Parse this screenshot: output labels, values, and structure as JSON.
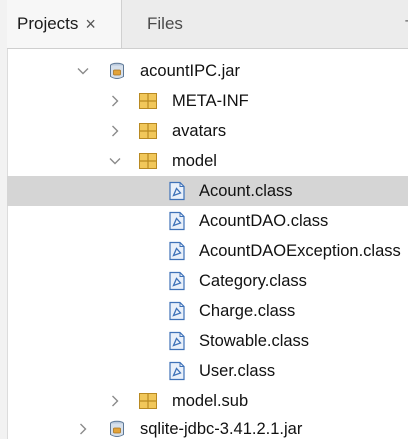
{
  "tabs": {
    "projects_label": "Projects",
    "close_glyph": "×",
    "files_label": "Files",
    "overflow_glyph": "-"
  },
  "tree": {
    "rows": [
      {
        "label": "acountIPC.jar",
        "icon": "jar-icon",
        "expander": "expanded"
      },
      {
        "label": "META-INF",
        "icon": "package-icon",
        "expander": "collapsed"
      },
      {
        "label": "avatars",
        "icon": "package-icon",
        "expander": "collapsed"
      },
      {
        "label": "model",
        "icon": "package-icon",
        "expander": "expanded"
      },
      {
        "label": "Acount.class",
        "icon": "class-file-icon",
        "selected": true
      },
      {
        "label": "AcountDAO.class",
        "icon": "class-file-icon"
      },
      {
        "label": "AcountDAOException.class",
        "icon": "class-file-icon"
      },
      {
        "label": "Category.class",
        "icon": "class-file-icon"
      },
      {
        "label": "Charge.class",
        "icon": "class-file-icon"
      },
      {
        "label": "Stowable.class",
        "icon": "class-file-icon"
      },
      {
        "label": "User.class",
        "icon": "class-file-icon"
      },
      {
        "label": "model.sub",
        "icon": "package-icon",
        "expander": "collapsed"
      },
      {
        "label": "sqlite-jdbc-3.41.2.1.jar",
        "icon": "jar-icon",
        "expander": "collapsed"
      }
    ]
  },
  "colors": {
    "selection": "#d5d5d5",
    "package": "#e8b84a",
    "class_file": "#3f72b8",
    "jar": "#6f8fb5"
  }
}
